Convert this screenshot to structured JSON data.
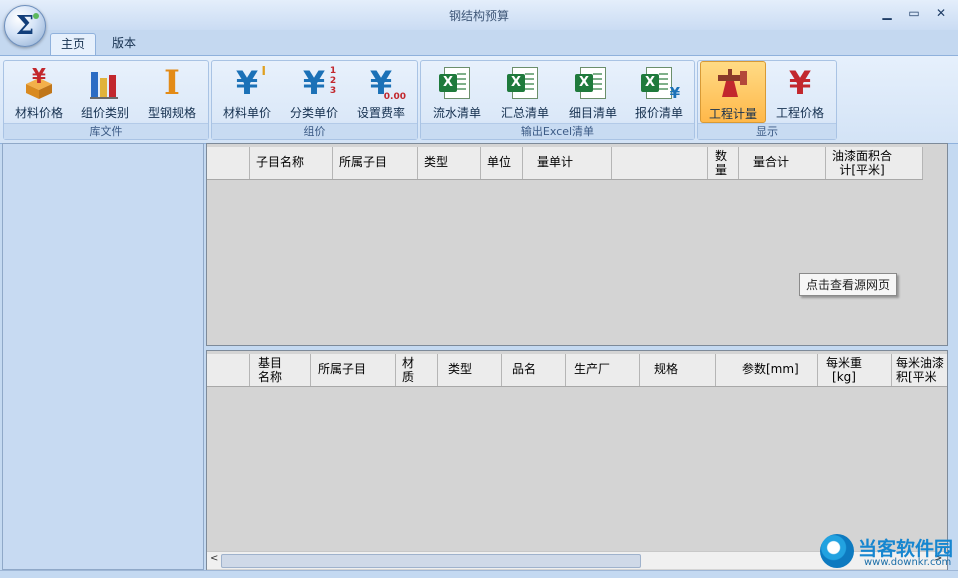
{
  "window": {
    "title": "钢结构预算",
    "app_icon_symbol": "Σ",
    "min_symbol": "▁",
    "max_symbol": "▭",
    "close_symbol": "✕"
  },
  "tabs": [
    {
      "label": "主页",
      "active": true
    },
    {
      "label": "版本",
      "active": false
    }
  ],
  "ribbon": {
    "groups": [
      {
        "label": "库文件",
        "buttons": [
          {
            "label": "材料价格",
            "icon": "yen-box-icon"
          },
          {
            "label": "组价类别",
            "icon": "bar-chart-icon"
          },
          {
            "label": "型钢规格",
            "icon": "i-beam-icon"
          }
        ]
      },
      {
        "label": "组价",
        "buttons": [
          {
            "label": "材料单价",
            "icon": "yen-icon"
          },
          {
            "label": "分类单价",
            "icon": "yen-123-icon"
          },
          {
            "label": "设置费率",
            "icon": "yen-rate-icon"
          }
        ]
      },
      {
        "label": "输出Excel清单",
        "buttons": [
          {
            "label": "流水清单",
            "icon": "excel-icon"
          },
          {
            "label": "汇总清单",
            "icon": "excel-list-icon"
          },
          {
            "label": "细目清单",
            "icon": "excel-detail-icon"
          },
          {
            "label": "报价清单",
            "icon": "excel-yen-icon"
          }
        ]
      },
      {
        "label": "显示",
        "buttons": [
          {
            "label": "工程计量",
            "icon": "pipe-valve-icon",
            "selected": true
          },
          {
            "label": "工程价格",
            "icon": "yen-red-icon"
          }
        ]
      }
    ],
    "glyphs": {
      "yen": "¥",
      "i_beam": "I",
      "sup_i": "I",
      "num_123": "1 2 3",
      "rate": "0.00"
    }
  },
  "upper_grid": {
    "columns": [
      "",
      "子目名称",
      "所属子目",
      "类型",
      "单位",
      "量单计",
      "",
      "数\n量",
      "量合计",
      "油漆面积合\n计[平米]"
    ]
  },
  "lower_grid": {
    "columns": [
      "",
      "基目\n名称",
      "所属子目",
      "材\n质",
      "类型",
      "品名",
      "生产厂",
      "规格",
      "参数[mm]",
      "每米重\n[kg]",
      "每米油漆\n积[平米"
    ]
  },
  "scrollbar": {
    "left_arrow": "<",
    "right_arrow": ">"
  },
  "tooltip": {
    "text": "点击查看源网页"
  },
  "watermark": {
    "text": "当客软件园",
    "url": "www.downkr.com"
  },
  "colors": {
    "accent_blue": "#1b71b7",
    "accent_red": "#c2272d",
    "ribbon_bg": "#dbe8f8",
    "grid_bg": "#d4d4d4",
    "highlight": "#ffb84a"
  }
}
